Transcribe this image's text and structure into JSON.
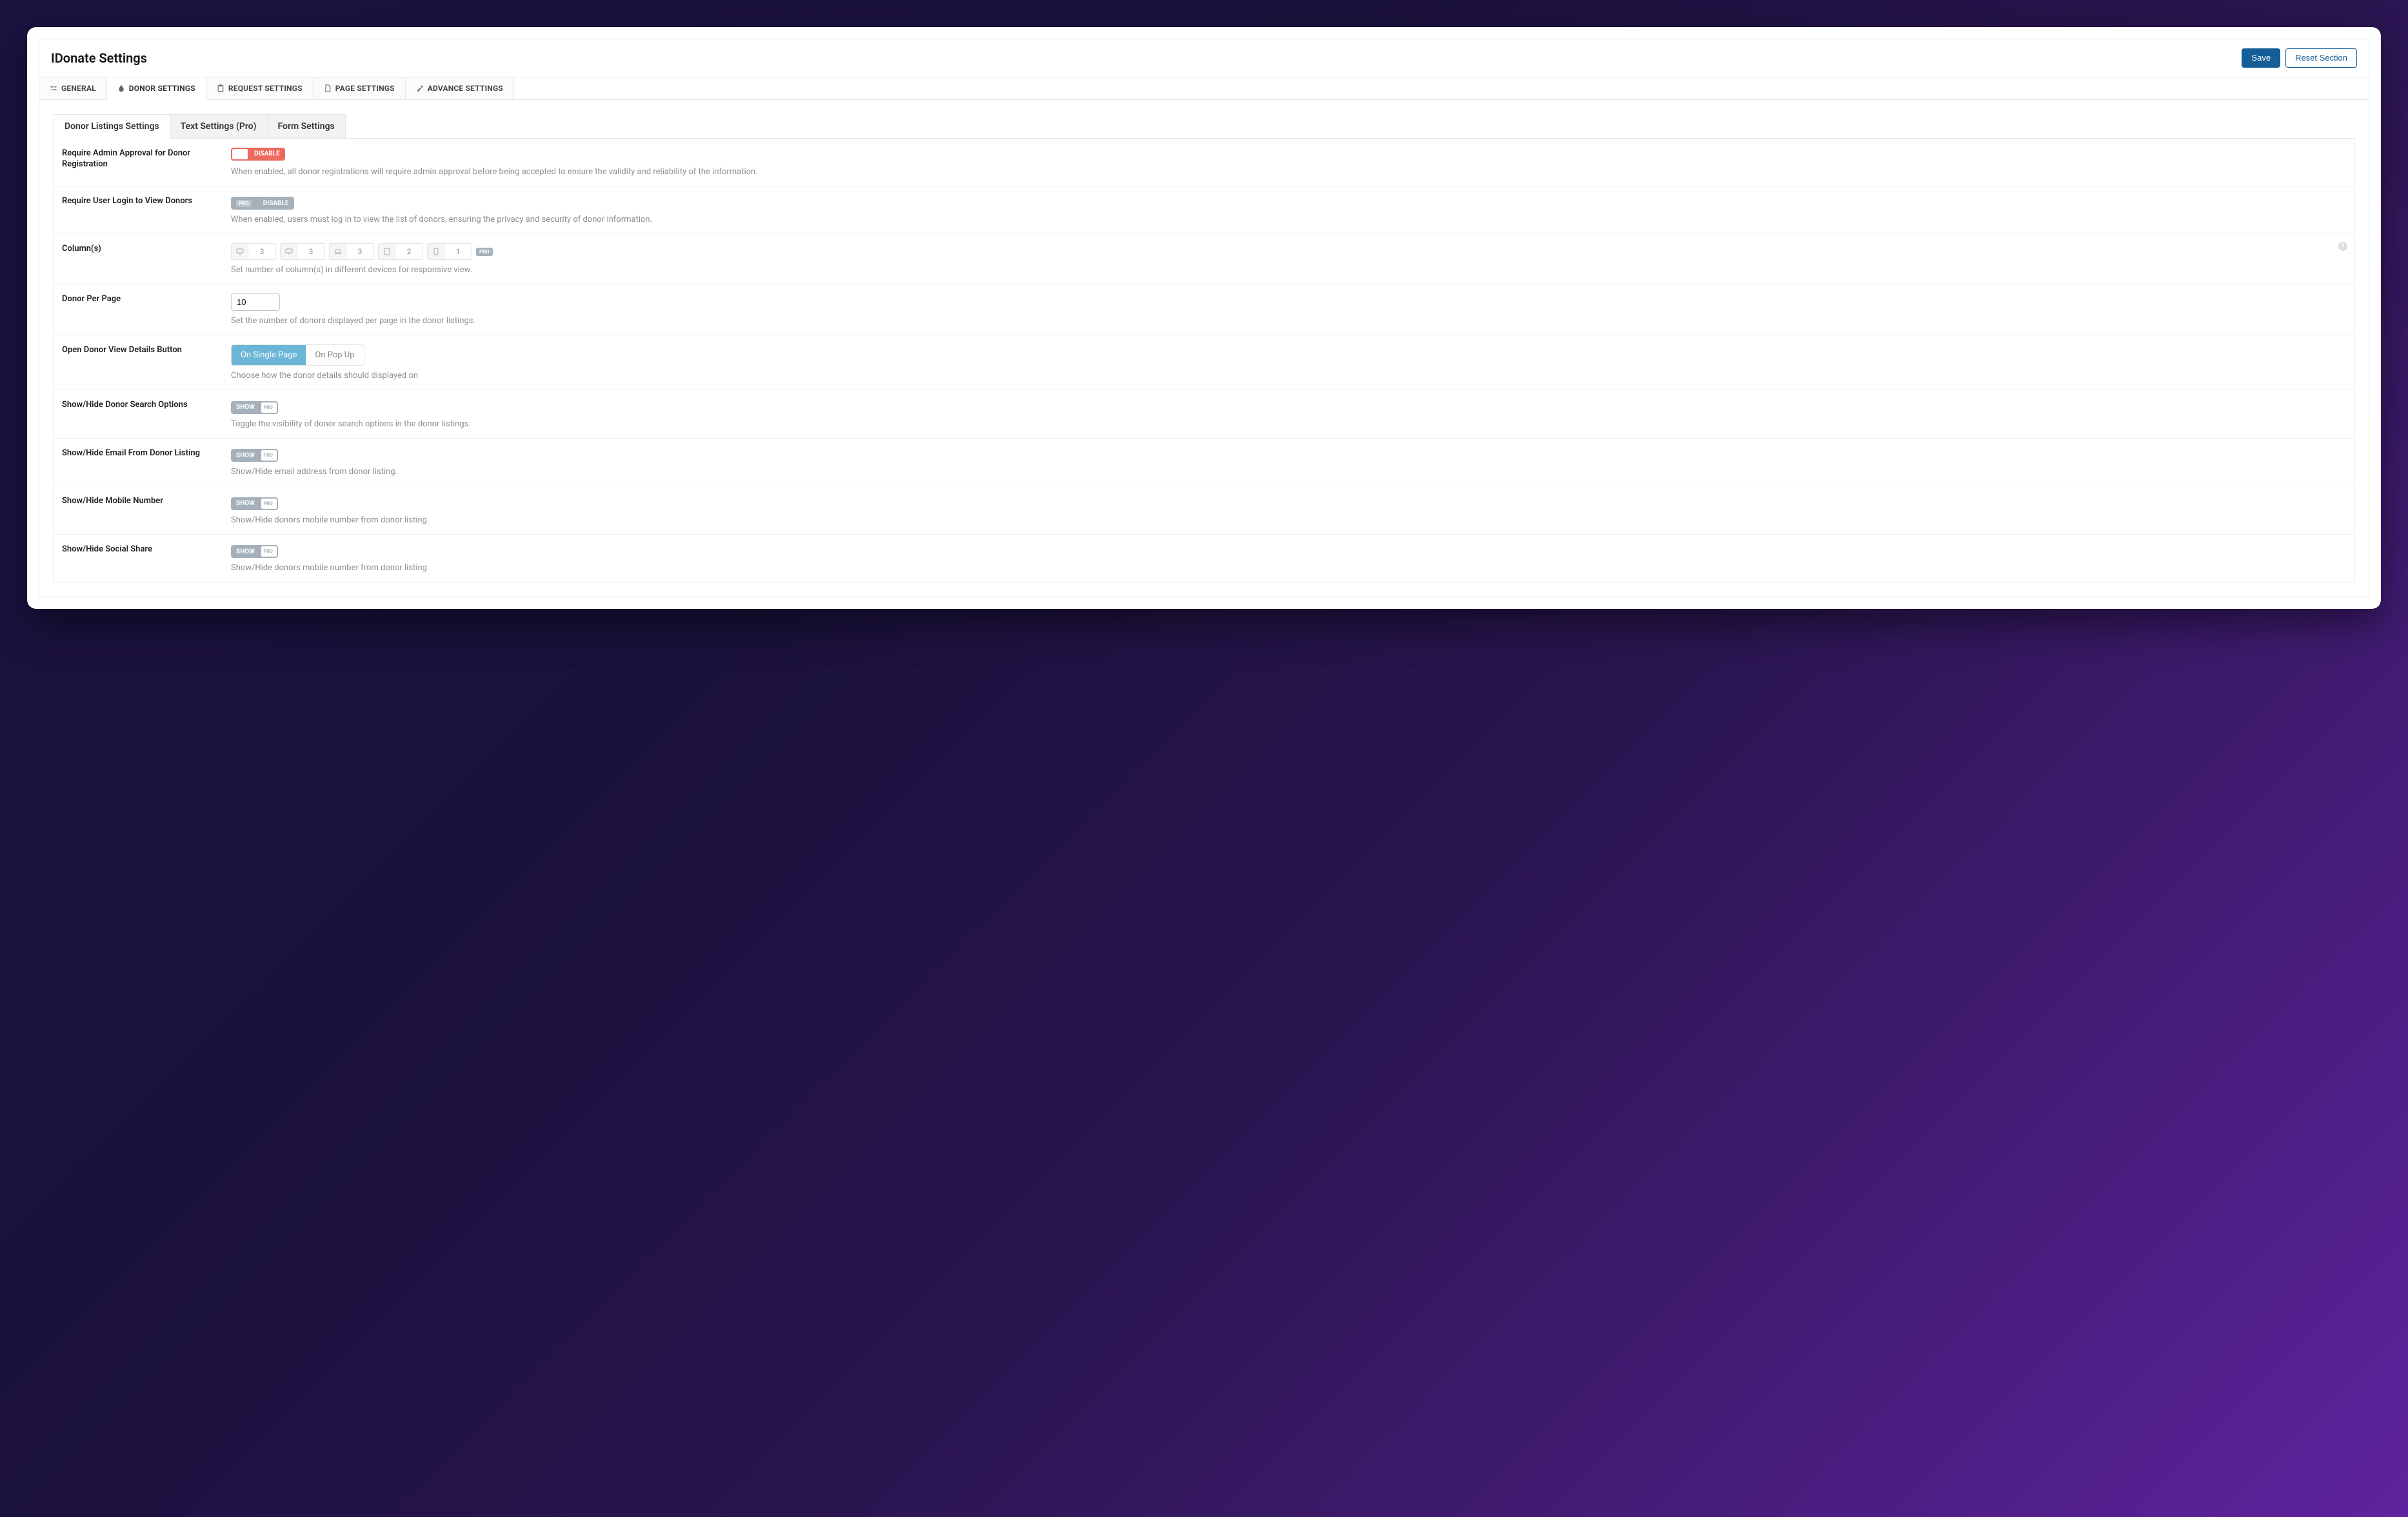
{
  "header": {
    "title": "IDonate Settings",
    "save_label": "Save",
    "reset_label": "Reset Section"
  },
  "main_tabs": [
    {
      "label": "GENERAL"
    },
    {
      "label": "DONOR SETTINGS"
    },
    {
      "label": "REQUEST SETTINGS"
    },
    {
      "label": "PAGE SETTINGS"
    },
    {
      "label": "ADVANCE SETTINGS"
    }
  ],
  "sub_tabs": [
    {
      "label": "Donor Listings Settings"
    },
    {
      "label": "Text Settings (Pro)"
    },
    {
      "label": "Form Settings"
    }
  ],
  "rows": {
    "r0": {
      "label": "Require Admin Approval for Donor Registration",
      "toggle_text": "DISABLE",
      "desc": "When enabled, all donor registrations will require admin approval before being accepted to ensure the validity and reliability of the information."
    },
    "r1": {
      "label": "Require User Login to View Donors",
      "toggle_pro": "PRO",
      "toggle_text": "DISABLE",
      "desc": "When enabled, users must log in to view the list of donors, ensuring the privacy and security of donor information."
    },
    "r2": {
      "label": "Column(s)",
      "cols": [
        "3",
        "3",
        "3",
        "2",
        "1"
      ],
      "pro": "PRO",
      "desc": "Set number of column(s) in different devices for responsive view."
    },
    "r3": {
      "label": "Donor Per Page",
      "value": "10",
      "desc": "Set the number of donors displayed per page in the donor listings."
    },
    "r4": {
      "label": "Open Donor View Details Button",
      "opt_a": "On Single Page",
      "opt_b": "On Pop Up",
      "desc": "Choose how the donor details should displayed on"
    },
    "r5": {
      "label": "Show/Hide Donor Search Options",
      "toggle_text": "SHOW",
      "toggle_pro": "PRO",
      "desc": "Toggle the visibility of donor search options in the donor listings."
    },
    "r6": {
      "label": "Show/Hide Email From Donor Listing",
      "toggle_text": "SHOW",
      "toggle_pro": "PRO",
      "desc": "Show/Hide email address from donor listing."
    },
    "r7": {
      "label": "Show/Hide Mobile Number",
      "toggle_text": "SHOW",
      "toggle_pro": "PRO",
      "desc": "Show/Hide donors mobile number from donor listing."
    },
    "r8": {
      "label": "Show/Hide Social Share",
      "toggle_text": "SHOW",
      "toggle_pro": "PRO",
      "desc": "Show/Hide donors mobile number from donor listing."
    }
  }
}
